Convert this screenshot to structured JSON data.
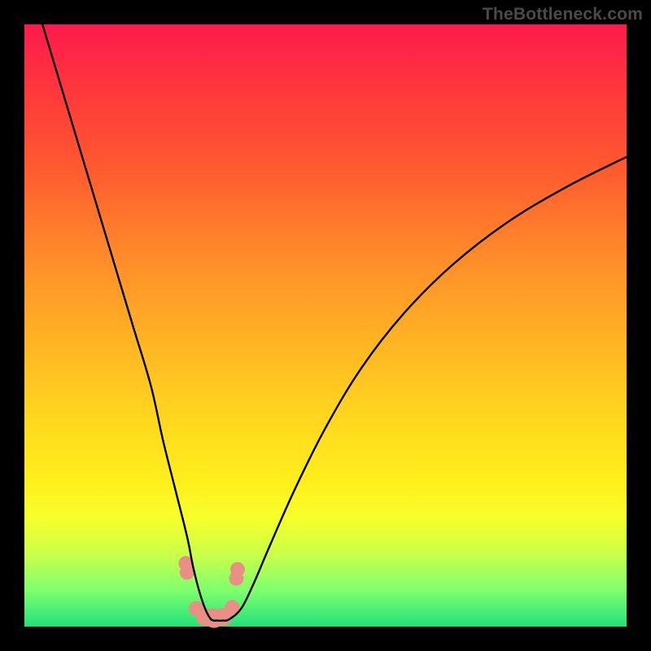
{
  "watermark": "TheBottleneck.com",
  "chart_data": {
    "type": "line",
    "title": "",
    "xlabel": "",
    "ylabel": "",
    "xlim": [
      0,
      100
    ],
    "ylim": [
      0,
      100
    ],
    "grid": false,
    "series": [
      {
        "name": "bottleneck-curve",
        "x": [
          3,
          6,
          9,
          12,
          15,
          18,
          21,
          23,
          25,
          27,
          28,
          29,
          30,
          31,
          32,
          33,
          34,
          36,
          38,
          41,
          45,
          50,
          56,
          63,
          71,
          80,
          90,
          100
        ],
        "values": [
          100,
          90,
          80,
          70,
          60,
          50,
          40,
          31,
          23,
          15,
          10,
          6,
          3,
          1.2,
          1.0,
          1.0,
          1.2,
          3,
          7,
          14,
          23,
          33,
          43,
          52,
          60,
          67,
          73,
          78
        ]
      }
    ],
    "markers": {
      "name": "highlight-dots",
      "color": "#e98f86",
      "x": [
        26.8,
        27.0,
        28.5,
        30.0,
        31.5,
        33.0,
        34.5,
        35.2,
        35.4
      ],
      "values": [
        10.5,
        9.0,
        3.0,
        1.6,
        1.4,
        1.6,
        3.2,
        8.0,
        9.5
      ],
      "radius": [
        9,
        9,
        9,
        11,
        12,
        11,
        9,
        9,
        9
      ]
    }
  }
}
